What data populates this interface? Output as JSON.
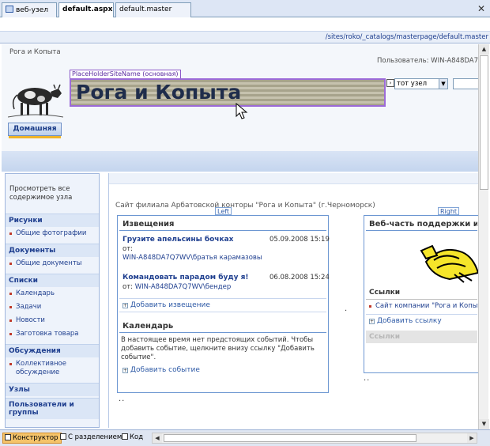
{
  "doc_tabs": [
    {
      "label": "веб-узел",
      "active": false
    },
    {
      "label": "default.aspx",
      "active": true
    },
    {
      "label": "default.master",
      "active": false
    }
  ],
  "close_glyph": "✕",
  "url": "/sites/roko/_catalogs/masterpage/default.master",
  "breadcrumb": "Рога и Копыта",
  "user_label": "Пользователь: WIN-A848DA7",
  "placeholder_label": "PlaceHolderSiteName (основная)",
  "site_title": "Рога и Копыта",
  "search": {
    "scope": "тот узел"
  },
  "home_tab": "Домашняя",
  "leftnav": {
    "view_all": "Просмотреть все содержимое узла",
    "sections": [
      {
        "head": "Рисунки",
        "items": [
          "Общие фотографии"
        ]
      },
      {
        "head": "Документы",
        "items": [
          "Общие документы"
        ]
      },
      {
        "head": "Списки",
        "items": [
          "Календарь",
          "Задачи",
          "Новости",
          "Заготовка товара"
        ]
      },
      {
        "head": "Обсуждения",
        "items": [
          "Коллективное обсуждение"
        ]
      },
      {
        "head": "Узлы",
        "items": []
      },
      {
        "head": "Пользователи и группы",
        "items": []
      }
    ]
  },
  "main": {
    "subtitle": "Сайт филиала Арбатовской конторы \"Рога и Копыта\" (г.Черноморск)",
    "left_zone_label": "Left",
    "right_zone_label": "Right",
    "announcements": {
      "title": "Извещения",
      "items": [
        {
          "title": "Грузите апельсины бочках",
          "date": "05.09.2008 15:19",
          "by_label": "от:",
          "author": "WIN-A848DA7Q7WV\\братья карамазовы"
        },
        {
          "title": "Командовать парадом буду я!",
          "date": "06.08.2008 15:24",
          "by_label": "от:",
          "author": "WIN-A848DA7Q7WV\\бендер"
        }
      ],
      "add_label": "Добавить извещение"
    },
    "calendar": {
      "title": "Календарь",
      "text": "В настоящее время нет предстоящих событий. Чтобы добавить событие, щелкните внизу ссылку \"Добавить событие\".",
      "add_label": "Добавить событие"
    },
    "support": {
      "title": "Веб-часть поддержки из"
    },
    "links": {
      "title": "Ссылки",
      "items": [
        "Сайт компании \"Рога и Копыта"
      ],
      "add_label": "Добавить ссылку",
      "footer": "Ссылки"
    }
  },
  "bottom_views": [
    {
      "label": "Конструктор",
      "active": true
    },
    {
      "label": "С разделением",
      "active": false
    },
    {
      "label": "Код",
      "active": false
    }
  ]
}
